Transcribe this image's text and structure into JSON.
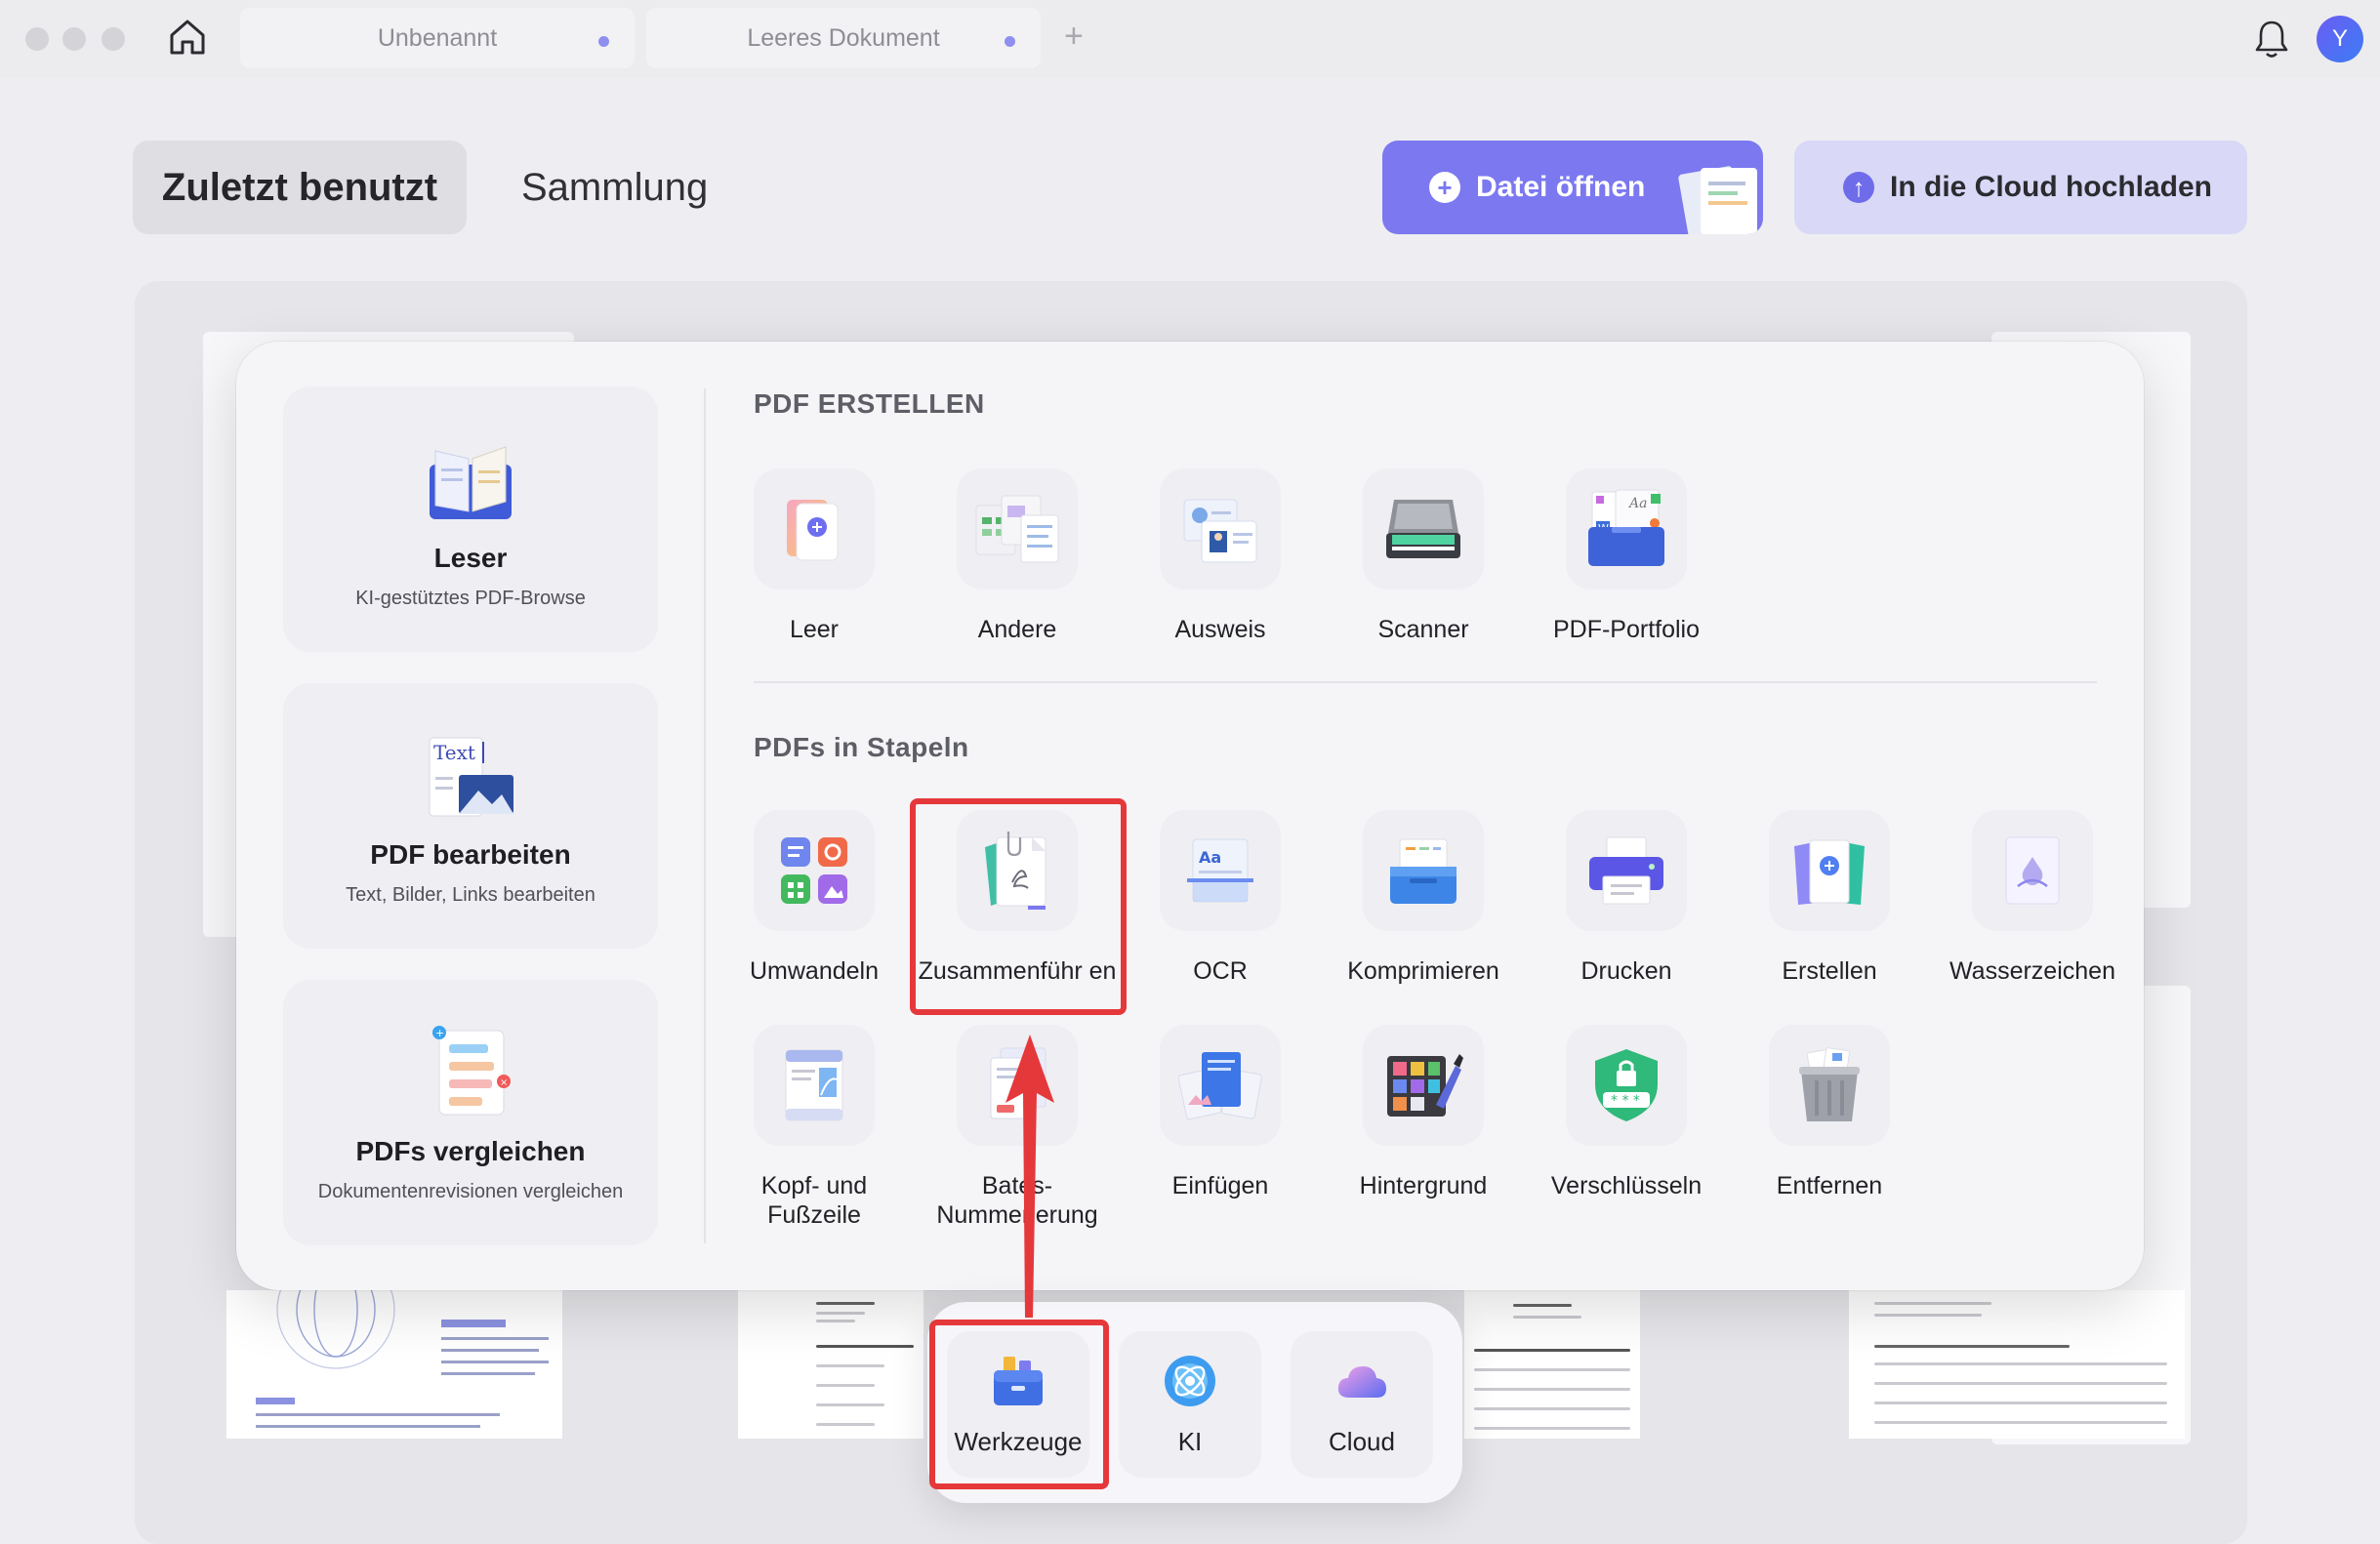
{
  "titlebar": {
    "tabs": [
      {
        "label": "Unbenannt"
      },
      {
        "label": "Leeres Dokument"
      }
    ],
    "add_tab": "+",
    "avatar_initial": "Y"
  },
  "header": {
    "segments": {
      "recent": "Zuletzt benutzt",
      "collection": "Sammlung"
    },
    "open_file": "Datei öffnen",
    "upload_cloud": "In die Cloud hochladen"
  },
  "popup": {
    "side": [
      {
        "title": "Leser",
        "subtitle": "KI-gestütztes PDF-Browse",
        "icon": "book-icon"
      },
      {
        "title": "PDF bearbeiten",
        "subtitle": "Text, Bilder, Links bearbeiten",
        "icon": "text-edit-icon"
      },
      {
        "title": "PDFs vergleichen",
        "subtitle": "Dokumentenrevisionen vergleichen",
        "icon": "compare-icon"
      }
    ],
    "create": {
      "title": "PDF ERSTELLEN",
      "tools": [
        {
          "label": "Leer",
          "icon": "blank-page-icon"
        },
        {
          "label": "Andere",
          "icon": "other-formats-icon"
        },
        {
          "label": "Ausweis",
          "icon": "id-card-icon"
        },
        {
          "label": "Scanner",
          "icon": "scanner-icon"
        },
        {
          "label": "PDF-Portfolio",
          "icon": "portfolio-icon"
        }
      ]
    },
    "batch": {
      "title": "PDFs in Stapeln",
      "row1": [
        {
          "label": "Umwandeln",
          "icon": "convert-icon"
        },
        {
          "label": "Zusammenführ en",
          "icon": "merge-icon"
        },
        {
          "label": "OCR",
          "icon": "ocr-icon"
        },
        {
          "label": "Komprimieren",
          "icon": "compress-icon"
        },
        {
          "label": "Drucken",
          "icon": "printer-icon"
        },
        {
          "label": "Erstellen",
          "icon": "create-icon"
        },
        {
          "label": "Wasserzeichen",
          "icon": "watermark-icon"
        }
      ],
      "row2": [
        {
          "label": "Kopf- und Fußzeile",
          "icon": "header-footer-icon"
        },
        {
          "label": "Bates- Nummerierung",
          "icon": "bates-icon"
        },
        {
          "label": "Einfügen",
          "icon": "insert-icon"
        },
        {
          "label": "Hintergrund",
          "icon": "background-icon"
        },
        {
          "label": "Verschlüsseln",
          "icon": "encrypt-icon"
        },
        {
          "label": "Entfernen",
          "icon": "trash-icon"
        }
      ]
    }
  },
  "dock": [
    {
      "label": "Werkzeuge",
      "icon": "toolbox-icon"
    },
    {
      "label": "KI",
      "icon": "ai-icon"
    },
    {
      "label": "Cloud",
      "icon": "cloud-icon"
    }
  ],
  "colors": {
    "accent": "#7b78f0",
    "highlight": "#e5383b"
  }
}
